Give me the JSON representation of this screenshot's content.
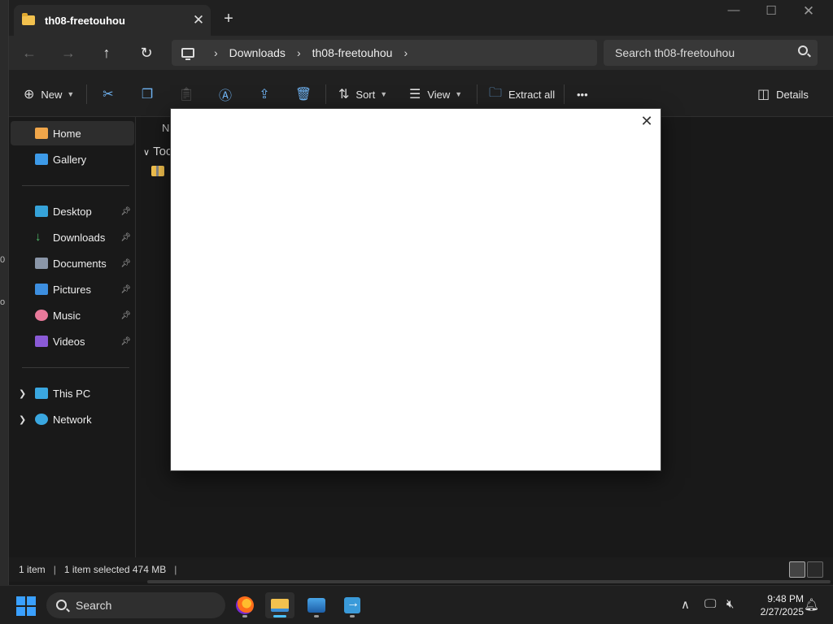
{
  "window": {
    "tab_title": "th08-freetouhou",
    "tab_close": "✕",
    "new_tab": "+",
    "minimize": "—",
    "maximize": "☐",
    "close": "✕"
  },
  "address": {
    "segments": [
      "Downloads",
      "th08-freetouhou"
    ],
    "separator": "›",
    "search_placeholder": "Search th08-freetouhou"
  },
  "commands": {
    "new_label": "New",
    "sort_label": "Sort",
    "view_label": "View",
    "extract_label": "Extract all",
    "more_label": "•••",
    "details_label": "Details"
  },
  "sidebar": {
    "items": [
      {
        "label": "Home",
        "icon": "home-icon",
        "pinned": false
      },
      {
        "label": "Gallery",
        "icon": "gallery-icon",
        "pinned": false
      },
      {
        "label": "Desktop",
        "icon": "desktop-icon",
        "pinned": true
      },
      {
        "label": "Downloads",
        "icon": "downloads-icon",
        "pinned": true
      },
      {
        "label": "Documents",
        "icon": "documents-icon",
        "pinned": true
      },
      {
        "label": "Pictures",
        "icon": "pictures-icon",
        "pinned": true
      },
      {
        "label": "Music",
        "icon": "music-icon",
        "pinned": true
      },
      {
        "label": "Videos",
        "icon": "videos-icon",
        "pinned": true
      },
      {
        "label": "This PC",
        "icon": "this-pc-icon",
        "pinned": false
      },
      {
        "label": "Network",
        "icon": "network-icon",
        "pinned": false
      }
    ]
  },
  "main": {
    "column_header": "Na",
    "group_header": "Toc"
  },
  "modal": {
    "close": "✕"
  },
  "status": {
    "item_count": "1 item",
    "selection": "1 item selected  474 MB"
  },
  "taskbar": {
    "search_label": "Search",
    "time": "9:48 PM",
    "date": "2/27/2025"
  },
  "desktop": {
    "fragment_1": "0",
    "fragment_2": "o"
  },
  "colors": {
    "accent": "#4cc2ff",
    "folder": "#f2c14e"
  }
}
